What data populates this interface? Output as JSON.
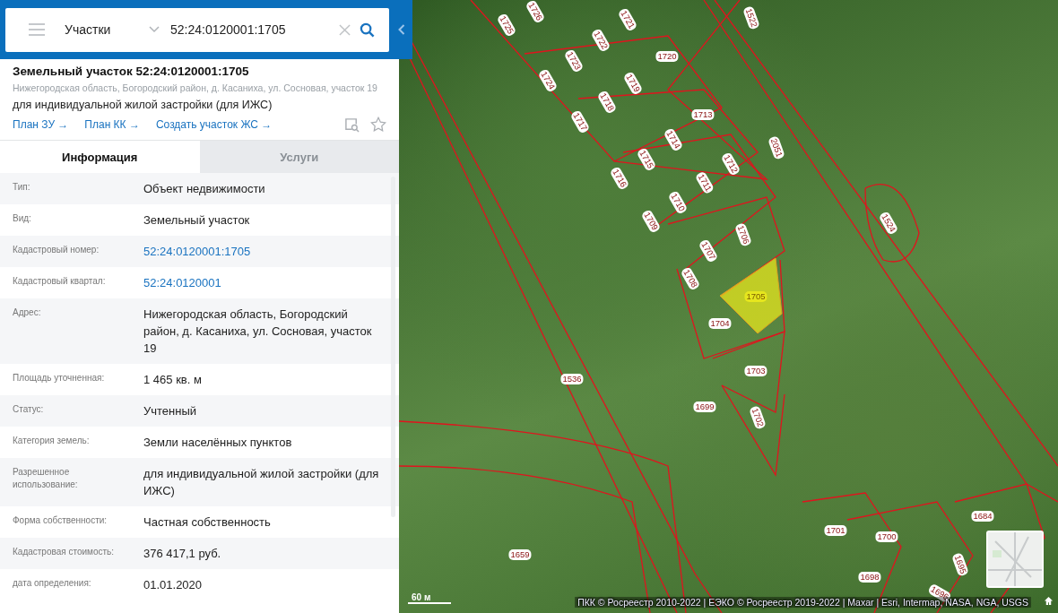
{
  "search": {
    "category": "Участки",
    "value": "52:24:0120001:1705"
  },
  "object": {
    "title": "Земельный участок 52:24:0120001:1705",
    "address": "Нижегородская область, Богородский район, д. Касаниха, ул. Сосновая, участок 19",
    "purpose": "для индивидуальной жилой застройки (для ИЖС)",
    "links": [
      "План ЗУ →",
      "План КК →",
      "Создать участок ЖС →"
    ],
    "favorite": false
  },
  "tabs": [
    {
      "label": "Информация",
      "selected": true
    },
    {
      "label": "Услуги",
      "selected": false
    }
  ],
  "info": [
    {
      "label": "Тип:",
      "value": "Объект недвижимости",
      "kind": "text"
    },
    {
      "label": "Вид:",
      "value": "Земельный участок",
      "kind": "text"
    },
    {
      "label": "Кадастровый номер:",
      "value": "52:24:0120001:1705",
      "kind": "link"
    },
    {
      "label": "Кадастровый квартал:",
      "value": "52:24:0120001",
      "kind": "link"
    },
    {
      "label": "Адрес:",
      "value": "Нижегородская область, Богородский район, д. Касаниха, ул. Сосновая, участок 19",
      "kind": "text"
    },
    {
      "label": "Площадь уточненная:",
      "value": "1 465 кв. м",
      "kind": "text"
    },
    {
      "label": "Статус:",
      "value": "Учтенный",
      "kind": "text"
    },
    {
      "label": "Категория земель:",
      "value": "Земли населённых пунктов",
      "kind": "text"
    },
    {
      "label": "Разрешенное использование:",
      "value": "для индивидуальной жилой застройки (для ИЖС)",
      "kind": "text"
    },
    {
      "label": "Форма собственности:",
      "value": "Частная собственность",
      "kind": "text"
    },
    {
      "label": "Кадастровая стоимость:",
      "value": "376 417,1 руб.",
      "kind": "text"
    },
    {
      "label": "дата определения:",
      "value": "01.01.2020",
      "kind": "text"
    }
  ],
  "map": {
    "parcels": [
      {
        "label": "1725",
        "selected": false
      },
      {
        "label": "1726",
        "selected": false
      },
      {
        "label": "1721",
        "selected": false
      },
      {
        "label": "1522",
        "selected": false
      },
      {
        "label": "1720",
        "selected": false
      },
      {
        "label": "1722",
        "selected": false
      },
      {
        "label": "1723",
        "selected": false
      },
      {
        "label": "1719",
        "selected": false
      },
      {
        "label": "1724",
        "selected": false
      },
      {
        "label": "1718",
        "selected": false
      },
      {
        "label": "1717",
        "selected": false
      },
      {
        "label": "1713",
        "selected": false
      },
      {
        "label": "2051",
        "selected": false
      },
      {
        "label": "1714",
        "selected": false
      },
      {
        "label": "1715",
        "selected": false
      },
      {
        "label": "1712",
        "selected": false
      },
      {
        "label": "1711",
        "selected": false
      },
      {
        "label": "1716",
        "selected": false
      },
      {
        "label": "1710",
        "selected": false
      },
      {
        "label": "1709",
        "selected": false
      },
      {
        "label": "1524",
        "selected": false
      },
      {
        "label": "1706",
        "selected": false
      },
      {
        "label": "1707",
        "selected": false
      },
      {
        "label": "1708",
        "selected": false
      },
      {
        "label": "1705",
        "selected": true
      },
      {
        "label": "1704",
        "selected": false
      },
      {
        "label": "1703",
        "selected": false
      },
      {
        "label": "1536",
        "selected": false
      },
      {
        "label": "1699",
        "selected": false
      },
      {
        "label": "1702",
        "selected": false
      },
      {
        "label": "1684",
        "selected": false
      },
      {
        "label": "1701",
        "selected": false
      },
      {
        "label": "1700",
        "selected": false
      },
      {
        "label": "1698",
        "selected": false
      },
      {
        "label": "1695",
        "selected": false
      },
      {
        "label": "1659",
        "selected": false
      },
      {
        "label": "1696",
        "selected": false
      }
    ],
    "scale": "60 м",
    "attribution": "ПКК © Росреестр 2010-2022 | ЕЭКО © Росреестр 2019-2022 | Maxar | Esri, Intermap, NASA, NGA, USGS"
  }
}
